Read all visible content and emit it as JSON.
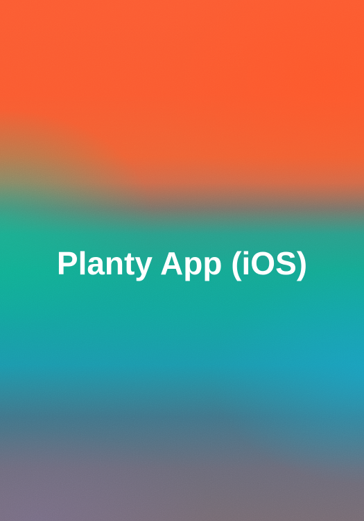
{
  "title": "Planty App (iOS)",
  "colors": {
    "top": "#fb5b32",
    "middle": "#14a892",
    "lower": "#1b98ac",
    "bottom": "#756a72",
    "text": "#ffffff"
  }
}
